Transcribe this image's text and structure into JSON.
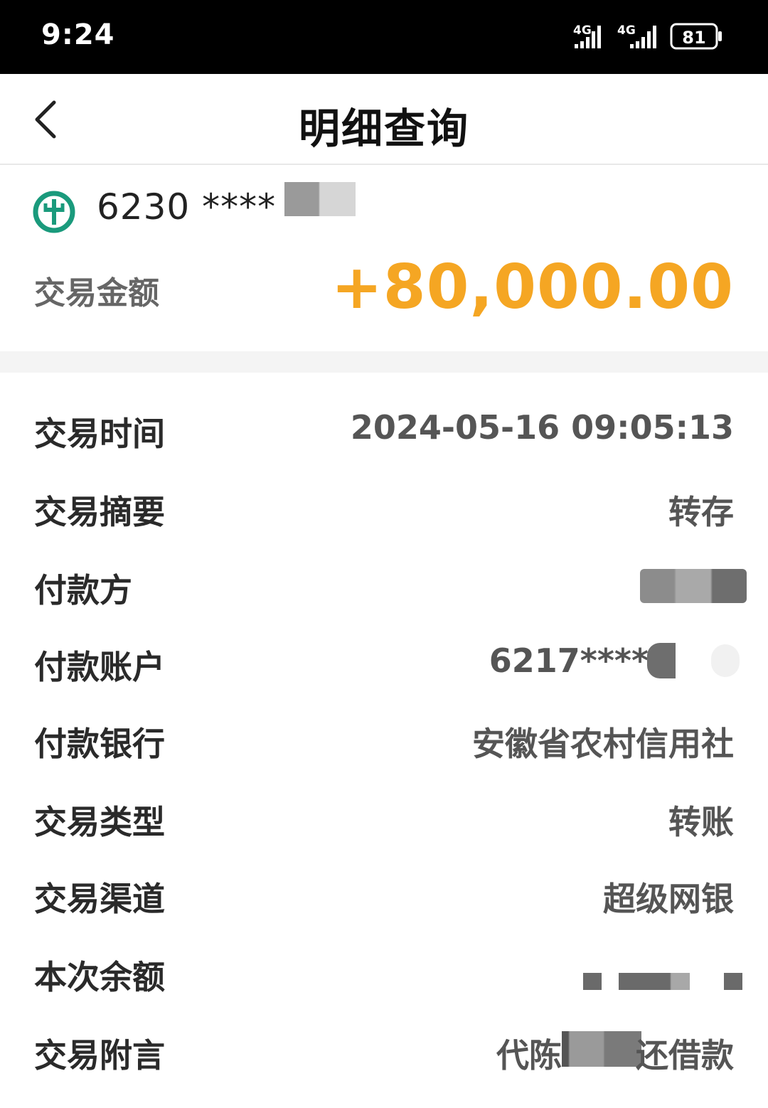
{
  "status_bar": {
    "time": "9:24",
    "network_1": "4G",
    "network_2": "4G",
    "battery": "81"
  },
  "header": {
    "title": "明细查询"
  },
  "card": {
    "number_prefix": "6230 ****",
    "logo": "agricultural-bank-logo-icon",
    "amount_label": "交易金额",
    "amount": "+80,000.00",
    "amount_color": "#f5a623"
  },
  "details": [
    {
      "label": "交易时间",
      "value": "2024-05-16 09:05:13"
    },
    {
      "label": "交易摘要",
      "value": "转存"
    },
    {
      "label": "付款方",
      "value": ""
    },
    {
      "label": "付款账户",
      "value": "6217****"
    },
    {
      "label": "付款银行",
      "value": "安徽省农村信用社"
    },
    {
      "label": "交易类型",
      "value": "转账"
    },
    {
      "label": "交易渠道",
      "value": "超级网银"
    },
    {
      "label": "本次余额",
      "value": ""
    },
    {
      "label": "交易附言",
      "value_prefix": "代陈",
      "value_suffix": "还借款"
    }
  ],
  "colors": {
    "accent": "#f5a623",
    "logo_green": "#1a9a7c"
  }
}
